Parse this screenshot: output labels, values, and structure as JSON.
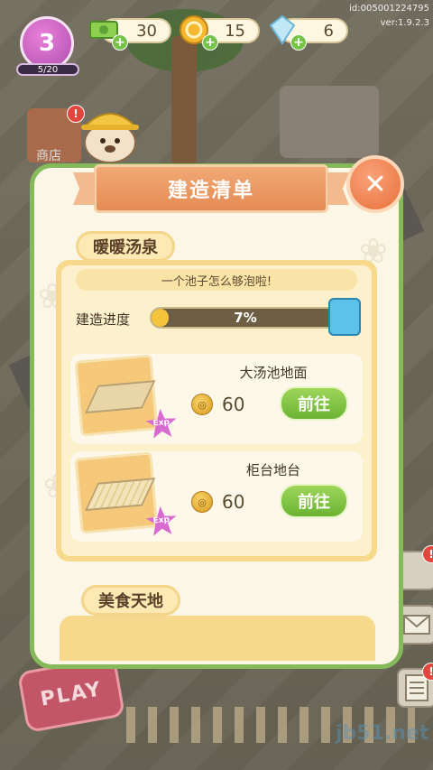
{
  "hud": {
    "level": "3",
    "xp": "5/20",
    "resources": [
      {
        "icon": "cash-icon",
        "value": "30"
      },
      {
        "icon": "coin-icon",
        "value": "15"
      },
      {
        "icon": "diamond-icon",
        "value": "6"
      }
    ],
    "account_id": "id:005001224795",
    "version": "ver:1.9.2.3"
  },
  "background": {
    "shop_label": "商店"
  },
  "dialog": {
    "title": "建造清单",
    "section": {
      "name": "暖暖汤泉",
      "subtitle": "一个池子怎么够泡啦!",
      "progress_label": "建造进度",
      "progress_text": "7%",
      "progress": 0.07,
      "items": [
        {
          "name": "大汤池地面",
          "cost": "60",
          "exp": "Exp",
          "go": "前往"
        },
        {
          "name": "柜台地台",
          "cost": "60",
          "exp": "Exp",
          "go": "前往"
        }
      ]
    },
    "next_section": "美食天地"
  },
  "play_button": "PLAY",
  "watermark": "jb51.net",
  "colors": {
    "accent_green": "#86b95a",
    "ribbon_orange": "#e58b55",
    "go_green": "#6bb332",
    "level_purple": "#b04fb0"
  }
}
